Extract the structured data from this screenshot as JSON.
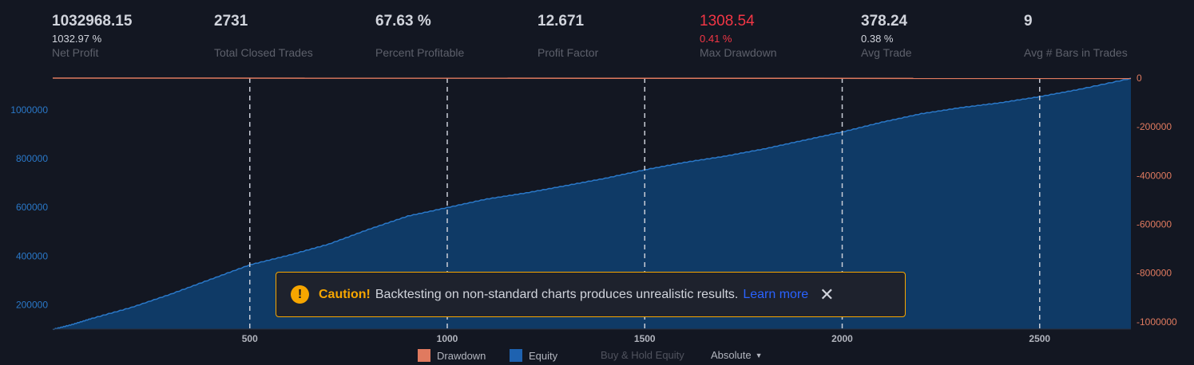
{
  "stats": [
    {
      "value": "1032968.15",
      "sub": "1032.97 %",
      "label": "Net Profit",
      "negative": false
    },
    {
      "value": "2731",
      "sub": "",
      "label": "Total Closed Trades",
      "negative": false
    },
    {
      "value": "67.63 %",
      "sub": "",
      "label": "Percent Profitable",
      "negative": false
    },
    {
      "value": "12.671",
      "sub": "",
      "label": "Profit Factor",
      "negative": false
    },
    {
      "value": "1308.54",
      "sub": "0.41 %",
      "label": "Max Drawdown",
      "negative": true
    },
    {
      "value": "378.24",
      "sub": "0.38 %",
      "label": "Avg Trade",
      "negative": false
    },
    {
      "value": "9",
      "sub": "",
      "label": "Avg # Bars in Trades",
      "negative": false
    }
  ],
  "toast": {
    "caution": "Caution!",
    "message": "Backtesting on non-standard charts produces unrealistic results.",
    "learn_more": "Learn more",
    "close": "✕",
    "icon": "warning-icon"
  },
  "legend": {
    "drawdown": "Drawdown",
    "equity": "Equity",
    "buy_hold": "Buy & Hold Equity",
    "mode": "Absolute",
    "mode_caret": "▼"
  },
  "colors": {
    "background": "#131722",
    "equity_line": "#2a78c8",
    "equity_fill": "#0f3a66",
    "drawdown": "#e07a5f",
    "caution": "#f7a600",
    "link": "#2962ff"
  },
  "chart_data": {
    "type": "area",
    "x_ticks": [
      500,
      1000,
      1500,
      2000,
      2500
    ],
    "xlim": [
      1,
      2731
    ],
    "y_left_ticks": [
      200000,
      400000,
      600000,
      800000,
      1000000
    ],
    "ylim_left": [
      100000,
      1130000
    ],
    "y_right_ticks": [
      0,
      -200000,
      -400000,
      -600000,
      -800000,
      -1000000
    ],
    "ylim_right": [
      -1030000,
      0
    ],
    "grid": "vertical dashed at x ticks",
    "series": [
      {
        "name": "Equity",
        "axis": "left",
        "x": [
          1,
          50,
          100,
          200,
          300,
          400,
          500,
          600,
          700,
          800,
          900,
          1000,
          1100,
          1200,
          1300,
          1400,
          1500,
          1600,
          1700,
          1800,
          1900,
          2000,
          2100,
          2200,
          2300,
          2400,
          2500,
          2600,
          2731
        ],
        "values": [
          100000,
          120000,
          145000,
          190000,
          245000,
          305000,
          365000,
          405000,
          450000,
          510000,
          565000,
          600000,
          635000,
          660000,
          690000,
          720000,
          755000,
          785000,
          810000,
          840000,
          875000,
          910000,
          950000,
          985000,
          1010000,
          1030000,
          1055000,
          1085000,
          1130000
        ]
      },
      {
        "name": "Drawdown",
        "axis": "right",
        "x": [
          1,
          2731
        ],
        "values": [
          0,
          -1308.54
        ]
      }
    ]
  }
}
